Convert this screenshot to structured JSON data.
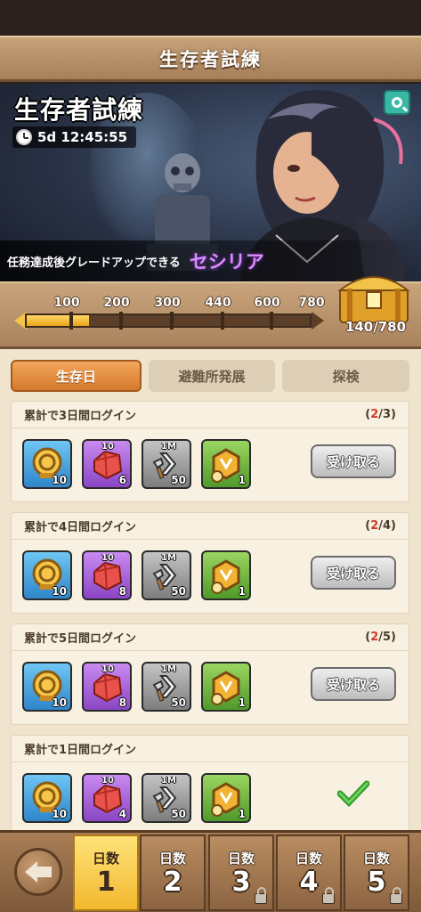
{
  "header": {
    "title": "生存者試練"
  },
  "banner": {
    "title": "生存者試練",
    "timer": "5d 12:45:55",
    "subtitle": "任務達成後グレードアップできる",
    "hero_name": "セシリア"
  },
  "progress": {
    "milestones": [
      "100",
      "200",
      "300",
      "440",
      "600",
      "780"
    ],
    "current": 140,
    "max": 780,
    "label": "140/780"
  },
  "tabs": [
    {
      "label": "生存日",
      "active": true
    },
    {
      "label": "避難所発展",
      "active": false
    },
    {
      "label": "探検",
      "active": false
    }
  ],
  "tasks": [
    {
      "title": "累計で3日間ログイン",
      "current": "2",
      "total": "/3)",
      "open": "(",
      "button": "受け取る",
      "rewards": [
        {
          "icon": "gold-medal-icon",
          "tag": "",
          "qty": "10"
        },
        {
          "icon": "red-gem-icon",
          "tag": "10",
          "qty": "6"
        },
        {
          "icon": "speedup-hammer-icon",
          "tag": "1M",
          "qty": "50"
        },
        {
          "icon": "hexagon-token-icon",
          "tag": "",
          "qty": "1"
        }
      ]
    },
    {
      "title": "累計で4日間ログイン",
      "current": "2",
      "total": "/4)",
      "open": "(",
      "button": "受け取る",
      "rewards": [
        {
          "icon": "gold-medal-icon",
          "tag": "",
          "qty": "10"
        },
        {
          "icon": "red-gem-icon",
          "tag": "10",
          "qty": "8"
        },
        {
          "icon": "speedup-hammer-icon",
          "tag": "1M",
          "qty": "50"
        },
        {
          "icon": "hexagon-token-icon",
          "tag": "",
          "qty": "1"
        }
      ]
    },
    {
      "title": "累計で5日間ログイン",
      "current": "2",
      "total": "/5)",
      "open": "(",
      "button": "受け取る",
      "rewards": [
        {
          "icon": "gold-medal-icon",
          "tag": "",
          "qty": "10"
        },
        {
          "icon": "red-gem-icon",
          "tag": "10",
          "qty": "8"
        },
        {
          "icon": "speedup-hammer-icon",
          "tag": "1M",
          "qty": "50"
        },
        {
          "icon": "hexagon-token-icon",
          "tag": "",
          "qty": "1"
        }
      ]
    },
    {
      "title": "累計で1日間ログイン",
      "current": "",
      "total": "",
      "open": "",
      "button": "",
      "rewards": [
        {
          "icon": "gold-medal-icon",
          "tag": "",
          "qty": "10"
        },
        {
          "icon": "red-gem-icon",
          "tag": "10",
          "qty": "4"
        },
        {
          "icon": "speedup-hammer-icon",
          "tag": "1M",
          "qty": "50"
        },
        {
          "icon": "hexagon-token-icon",
          "tag": "",
          "qty": "1"
        }
      ]
    }
  ],
  "days": [
    {
      "label": "日数",
      "num": "1",
      "active": true,
      "locked": false
    },
    {
      "label": "日数",
      "num": "2",
      "active": false,
      "locked": false
    },
    {
      "label": "日数",
      "num": "3",
      "active": false,
      "locked": true
    },
    {
      "label": "日数",
      "num": "4",
      "active": false,
      "locked": true
    },
    {
      "label": "日数",
      "num": "5",
      "active": false,
      "locked": true
    }
  ]
}
